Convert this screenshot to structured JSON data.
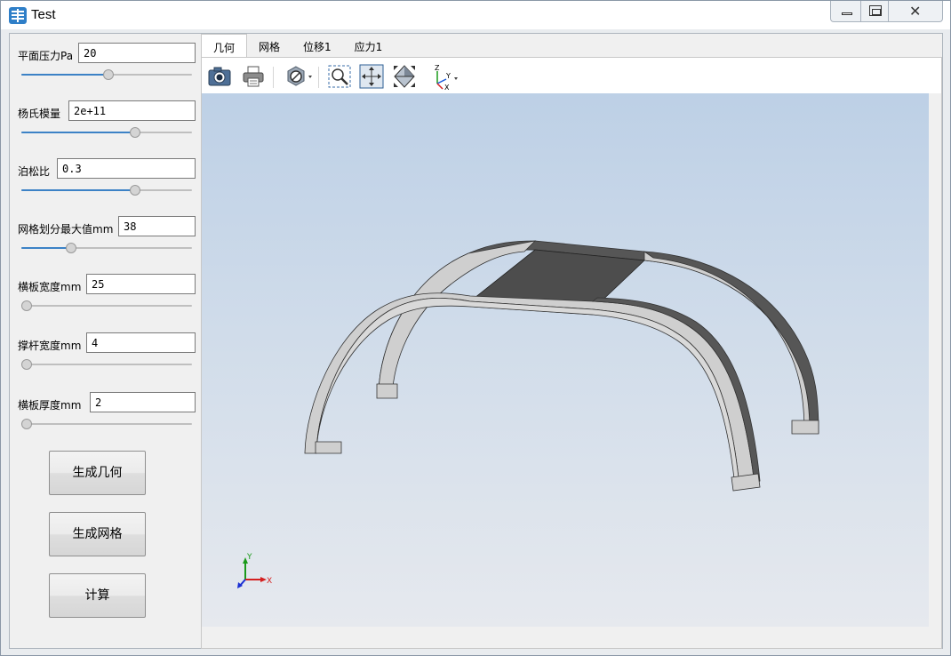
{
  "window": {
    "title": "Test",
    "controls": {
      "minimize": "minimize",
      "maximize": "maximize",
      "close": "✕"
    }
  },
  "params": [
    {
      "label": "平面压力Pa",
      "value": "20",
      "slider_fraction": 0.51
    },
    {
      "label": "杨氏模量",
      "value": "2e+11",
      "slider_fraction": 0.68
    },
    {
      "label": "泊松比",
      "value": "0.3",
      "slider_fraction": 0.68
    },
    {
      "label": "网格划分最大值mm",
      "value": "38",
      "slider_fraction": 0.28
    },
    {
      "label": "横板宽度mm",
      "value": "25",
      "slider_fraction": 0.0
    },
    {
      "label": "撑杆宽度mm",
      "value": "4",
      "slider_fraction": 0.0
    },
    {
      "label": "横板厚度mm",
      "value": "2",
      "slider_fraction": 0.0
    }
  ],
  "buttons": {
    "generate_geometry": "生成几何",
    "generate_mesh": "生成网格",
    "compute": "计算"
  },
  "tabs": [
    {
      "label": "几何",
      "active": true
    },
    {
      "label": "网格",
      "active": false
    },
    {
      "label": "位移1",
      "active": false
    },
    {
      "label": "应力1",
      "active": false
    }
  ],
  "toolbar": {
    "icons": [
      "camera-icon",
      "print-icon",
      "visibility-filter-icon",
      "zoom-box-icon",
      "zoom-extents-icon",
      "fit-view-icon",
      "axis-orientation-icon"
    ]
  },
  "viewport": {
    "axis_triad": {
      "x": "X",
      "y": "Y"
    },
    "toolbar_axis": {
      "x": "X",
      "y": "Y",
      "z": "Z"
    },
    "colors": {
      "background_top": "#bdd0e6",
      "background_bottom": "#e6e9ee",
      "arch_face": "#cfcfcf",
      "arch_side": "#555555",
      "plate": "#4d4d4d"
    }
  }
}
